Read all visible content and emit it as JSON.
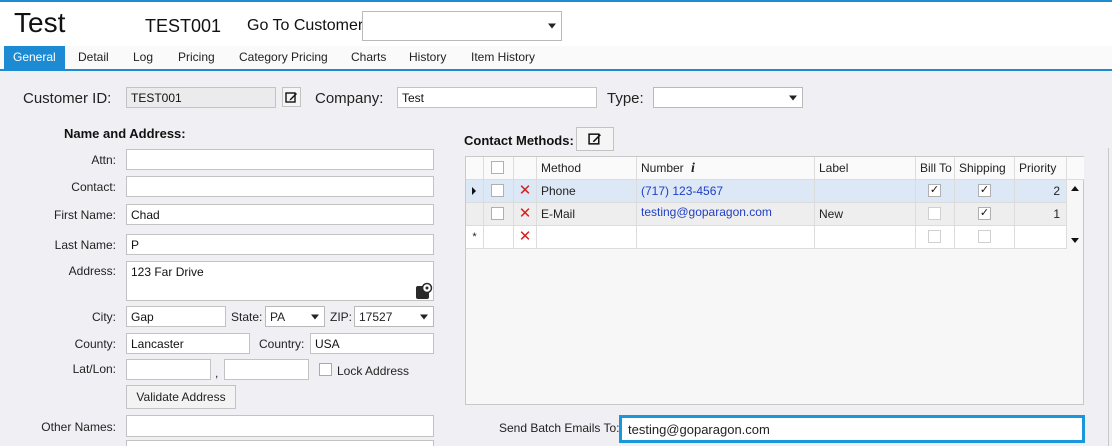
{
  "header": {
    "title": "Test",
    "customer_code": "TEST001",
    "goto_label": "Go To Customer:",
    "goto_value": ""
  },
  "tabs": [
    "General",
    "Detail",
    "Log",
    "Pricing",
    "Category Pricing",
    "Charts",
    "History",
    "Item History"
  ],
  "active_tab": "General",
  "top_fields": {
    "customer_id_label": "Customer ID:",
    "customer_id": "TEST001",
    "company_label": "Company:",
    "company": "Test",
    "type_label": "Type:",
    "type": ""
  },
  "name_address": {
    "section_title": "Name and Address:",
    "attn_label": "Attn:",
    "attn": "",
    "contact_label": "Contact:",
    "contact": "",
    "first_name_label": "First Name:",
    "first_name": "Chad",
    "last_name_label": "Last Name:",
    "last_name": "P",
    "address_label": "Address:",
    "address": "123 Far Drive",
    "city_label": "City:",
    "city": "Gap",
    "state_label": "State:",
    "state": "PA",
    "zip_label": "ZIP:",
    "zip": "17527",
    "county_label": "County:",
    "county": "Lancaster",
    "country_label": "Country:",
    "country": "USA",
    "latlon_label": "Lat/Lon:",
    "lat": "",
    "lon": "",
    "latlon_sep": ",",
    "lock_address_label": "Lock Address",
    "lock_address_checked": false,
    "validate_button": "Validate Address",
    "other_names_label": "Other Names:",
    "other_names": ""
  },
  "contact_methods": {
    "section_title": "Contact Methods:",
    "columns": [
      "Method",
      "Number",
      "Label",
      "Bill To",
      "Shipping",
      "Priority"
    ],
    "info_glyph": "i",
    "rows": [
      {
        "method": "Phone",
        "number": "(717) 123-4567",
        "label": "",
        "bill_to": true,
        "shipping": true,
        "priority": "2",
        "selected": true
      },
      {
        "method": "E-Mail",
        "number": "testing@goparagon.com",
        "label": "New",
        "bill_to": false,
        "shipping": true,
        "priority": "1",
        "selected": false
      }
    ],
    "new_row_marker": "*"
  },
  "batch_email": {
    "label": "Send Batch Emails To:",
    "value": "testing@goparagon.com"
  },
  "colors": {
    "accent": "#1d8ad4",
    "link": "#1f3ec7",
    "delete": "#d81e1e",
    "selected_row": "#dde8f6",
    "focus_border": "#1a96dc"
  },
  "icons": [
    "edit-icon",
    "map-pin-icon",
    "delete-icon",
    "dropdown-arrow-icon",
    "info-icon",
    "row-pointer-icon",
    "new-row-icon",
    "scroll-up-icon",
    "scroll-down-icon"
  ]
}
